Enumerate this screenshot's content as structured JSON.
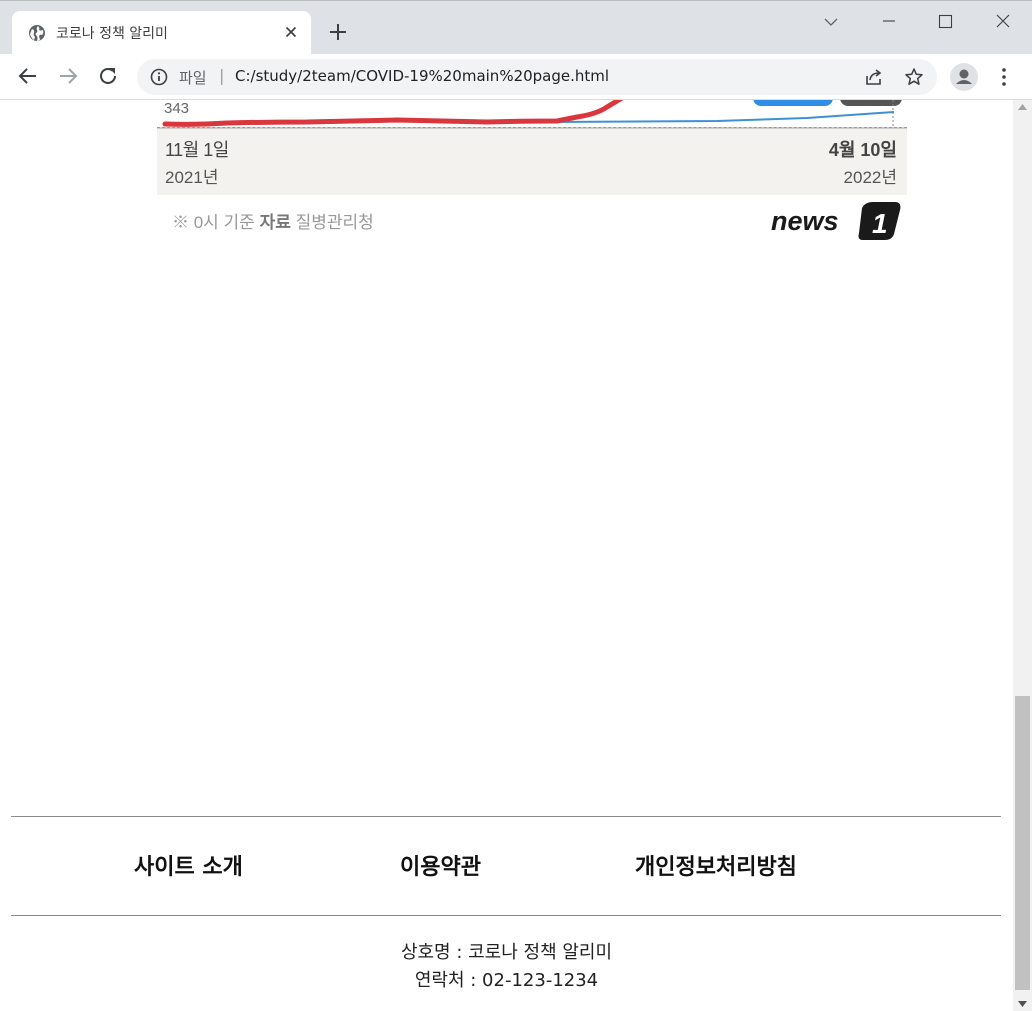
{
  "browser": {
    "tab_title": "코로나 정책 알리미",
    "scheme_label": "파일",
    "scheme_separator": "|",
    "url": "C:/study/2team/COVID-19%20main%20page.html"
  },
  "chart_image": {
    "value_label": "343",
    "start_date": "11월 1일",
    "start_year": "2021년",
    "end_date": "4월 10일",
    "end_year": "2022년",
    "note_prefix": "※ 0시 기준",
    "note_source_label": "자료",
    "note_source": "질병관리청",
    "logo_text": "news",
    "logo_mark": "1"
  },
  "footer": {
    "links": [
      "사이트 소개",
      "이용약관",
      "개인정보처리방침"
    ],
    "company": "상호명 : 코로나 정책 알리미",
    "contact": "연락처 : 02-123-1234"
  },
  "colors": {
    "series_red": "#d9363e",
    "series_blue": "#3d8fd8",
    "footer_band": "#f4f2ee"
  }
}
